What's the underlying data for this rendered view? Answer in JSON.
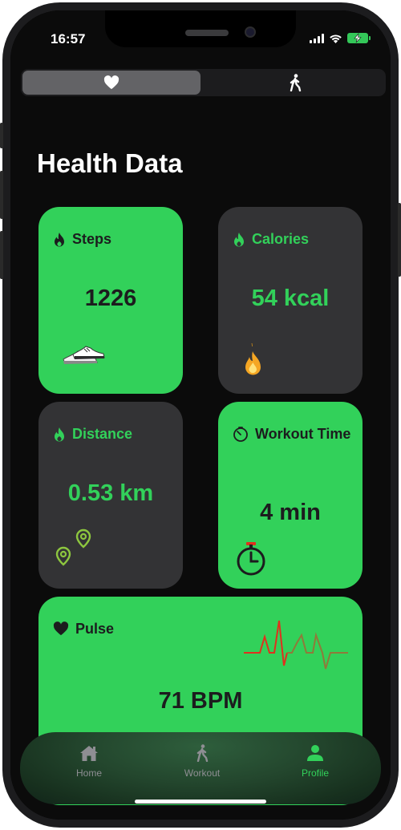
{
  "status_bar": {
    "time": "16:57"
  },
  "top_tabs": [
    {
      "icon": "heart-icon",
      "active": true
    },
    {
      "icon": "walking-icon",
      "active": false
    }
  ],
  "page_title": "Health Data",
  "cards": {
    "steps": {
      "label": "Steps",
      "value": "1226",
      "icon": "flame-icon",
      "image": "sneakers-icon"
    },
    "calories": {
      "label": "Calories",
      "value": "54 kcal",
      "icon": "flame-icon",
      "image": "fire-icon"
    },
    "distance": {
      "label": "Distance",
      "value": "0.53 km",
      "icon": "flame-icon",
      "image": "location-pins-icon"
    },
    "workout_time": {
      "label": "Workout Time",
      "value": "4 min",
      "icon": "timer-icon",
      "image": "stopwatch-icon"
    },
    "pulse": {
      "label": "Pulse",
      "value": "71 BPM",
      "icon": "heart-icon",
      "image": "heartbeat-line-icon"
    }
  },
  "tab_bar": {
    "items": [
      {
        "label": "Home",
        "icon": "house-icon"
      },
      {
        "label": "Workout",
        "icon": "walking-icon"
      },
      {
        "label": "Profile",
        "icon": "person-icon",
        "selected": true
      }
    ]
  },
  "colors": {
    "accent": "#32d15a",
    "card_dark": "#333335",
    "background": "#0b0b0b",
    "tab_inactive": "#8e8e93"
  }
}
